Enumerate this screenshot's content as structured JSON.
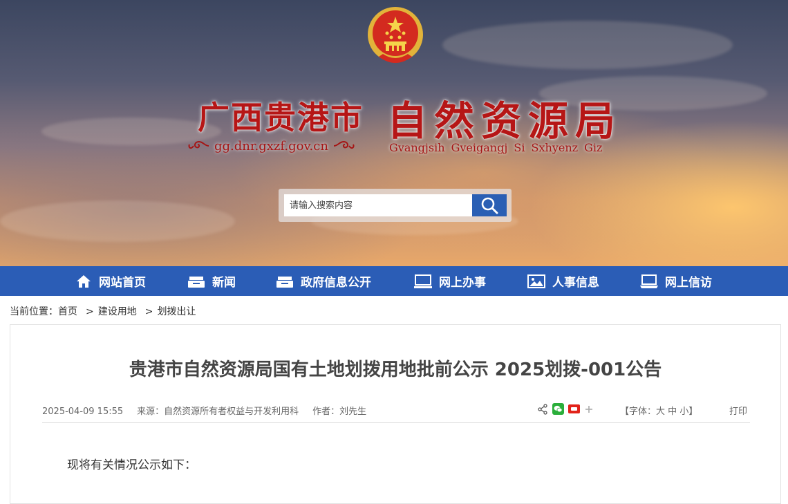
{
  "header": {
    "title_left": "广西贵港市",
    "title_right": "自然资源局",
    "domain": "gg.dnr.gxzf.gov.cn",
    "subtitle_zhuang": "Gvangjsih Gveigangj Si Sxhyenz Giz",
    "search_placeholder": "请输入搜索内容"
  },
  "nav": {
    "items": [
      {
        "label": "网站首页",
        "icon": "home-icon"
      },
      {
        "label": "新闻",
        "icon": "news-icon"
      },
      {
        "label": "政府信息公开",
        "icon": "info-icon"
      },
      {
        "label": "网上办事",
        "icon": "monitor-icon"
      },
      {
        "label": "人事信息",
        "icon": "image-icon"
      },
      {
        "label": "网上信访",
        "icon": "laptop-icon"
      }
    ]
  },
  "breadcrumb": {
    "prefix": "当前位置：",
    "items": [
      "首页",
      "建设用地",
      "划拨出让"
    ],
    "separator": ">"
  },
  "article": {
    "title": "贵港市自然资源局国有土地划拨用地批前公示 2025划拨-001公告",
    "date": "2025-04-09 15:55",
    "source": "来源：自然资源所有者权益与开发利用科",
    "author": "作者：刘先生",
    "font_label_open": "【字体：",
    "font_large": "大",
    "font_medium": "中",
    "font_small": "小",
    "font_label_close": "】",
    "print": "打印",
    "body": "现将有关情况公示如下："
  },
  "colors": {
    "nav_bg": "#2b5db6",
    "title_red": "#b61616",
    "search_btn": "#2a5fb4"
  }
}
